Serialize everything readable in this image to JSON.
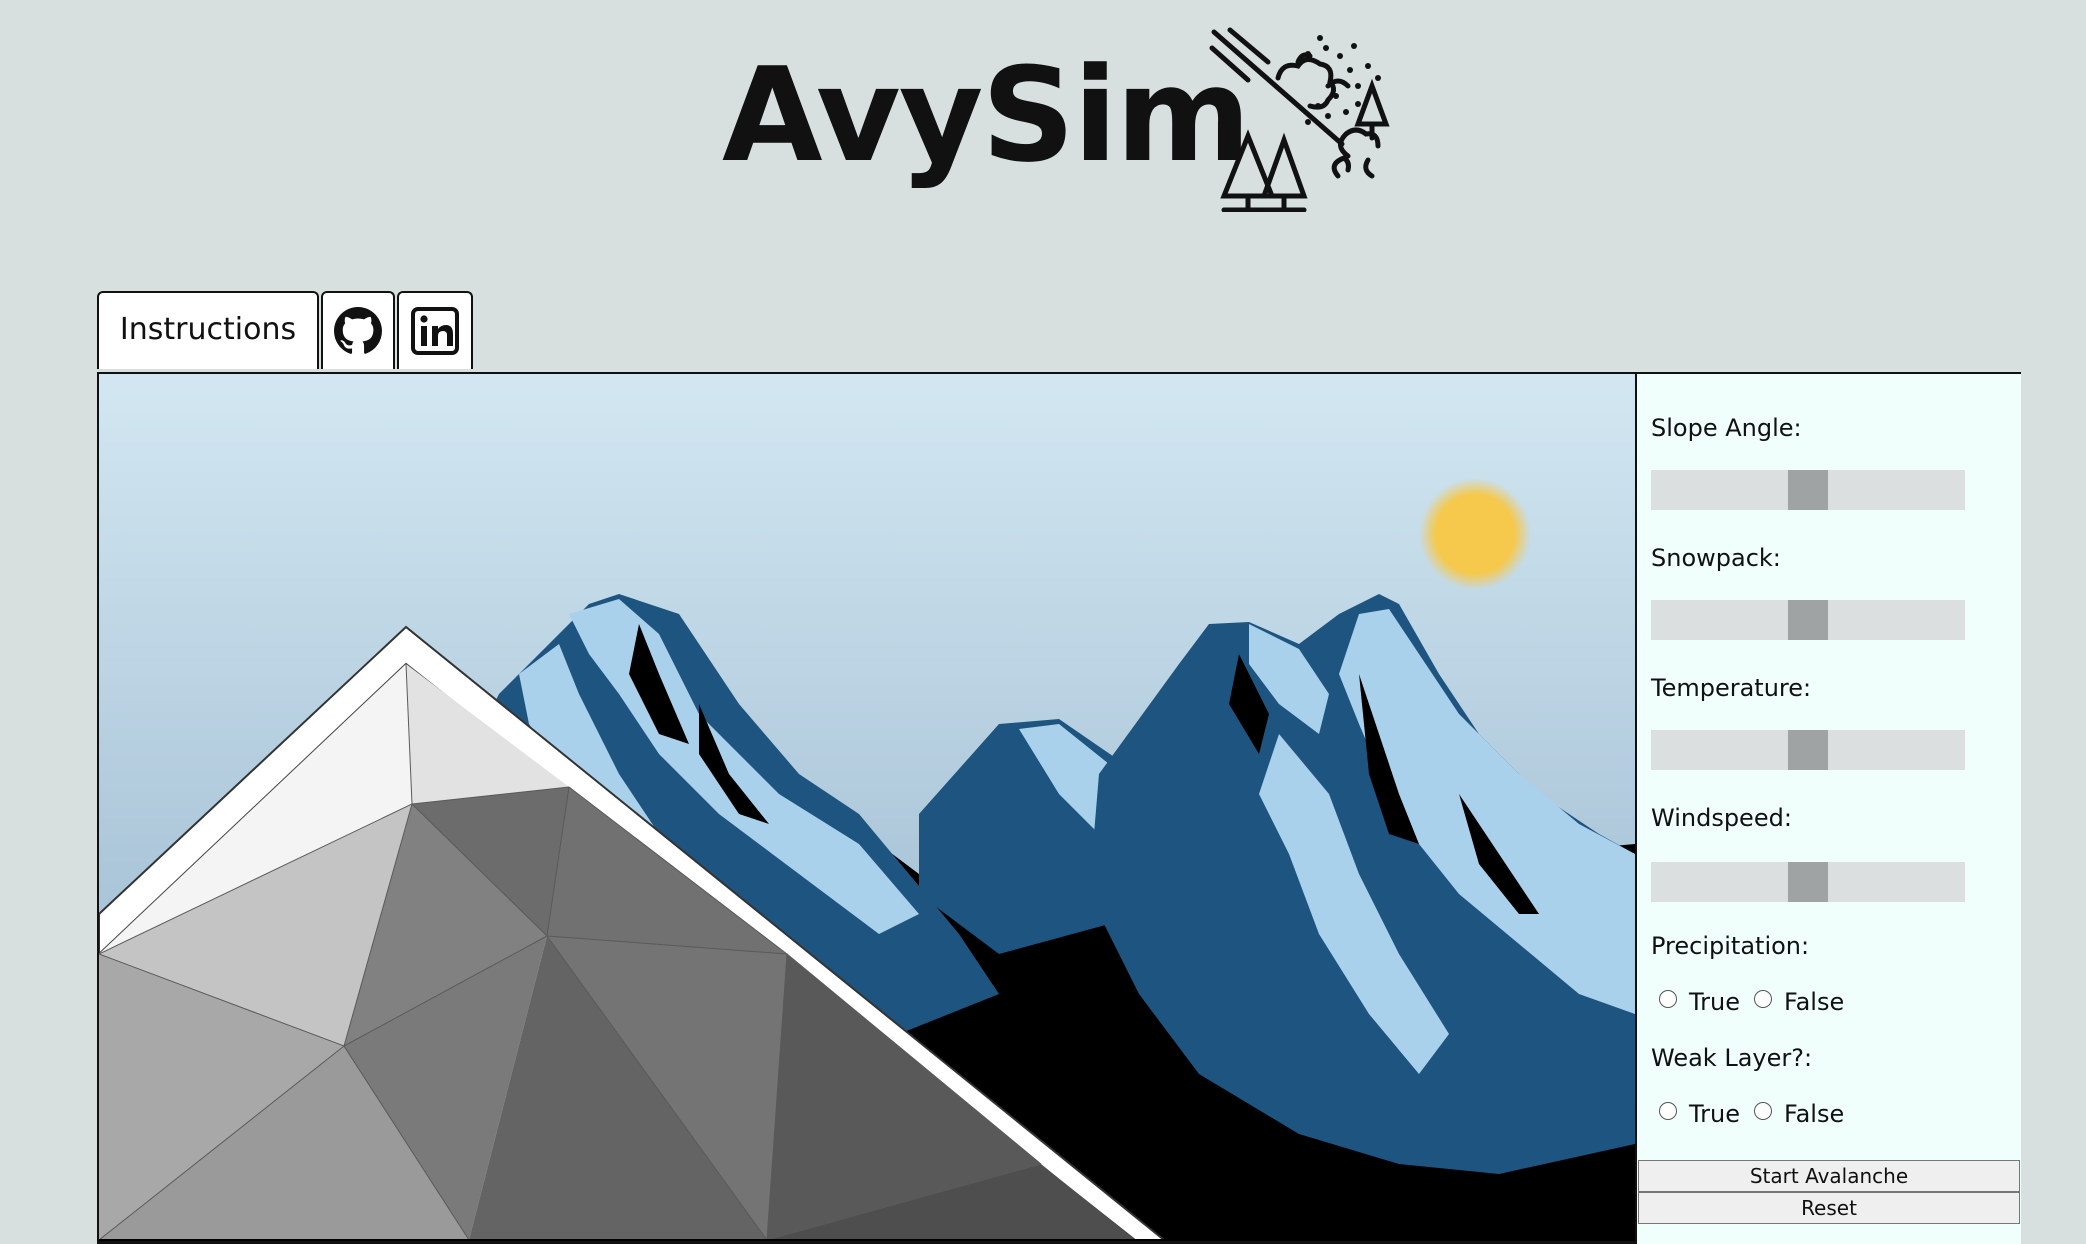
{
  "header": {
    "title": "AvySim",
    "logo_icon": "avalanche-icon"
  },
  "tabs": [
    {
      "label": "Instructions",
      "icon": null
    },
    {
      "label": "",
      "icon": "github-icon"
    },
    {
      "label": "",
      "icon": "linkedin-icon"
    }
  ],
  "scene": {
    "sky_top": "#d2e7f1",
    "sky_bottom": "#91afc9",
    "sun_color": "#f6c84b",
    "mountain_dark": "#1e5480",
    "mountain_snow": "#a9d1ec"
  },
  "controls": {
    "slope_angle": {
      "label": "Slope Angle:",
      "value_fraction": 0.5
    },
    "snowpack": {
      "label": "Snowpack:",
      "value_fraction": 0.5
    },
    "temperature": {
      "label": "Temperature:",
      "value_fraction": 0.5
    },
    "windspeed": {
      "label": "Windspeed:",
      "value_fraction": 0.5
    },
    "precipitation": {
      "label": "Precipitation:",
      "true_label": "True",
      "false_label": "False"
    },
    "weak_layer": {
      "label": "Weak Layer?:",
      "true_label": "True",
      "false_label": "False"
    },
    "start_button": "Start Avalanche",
    "reset_button": "Reset"
  }
}
